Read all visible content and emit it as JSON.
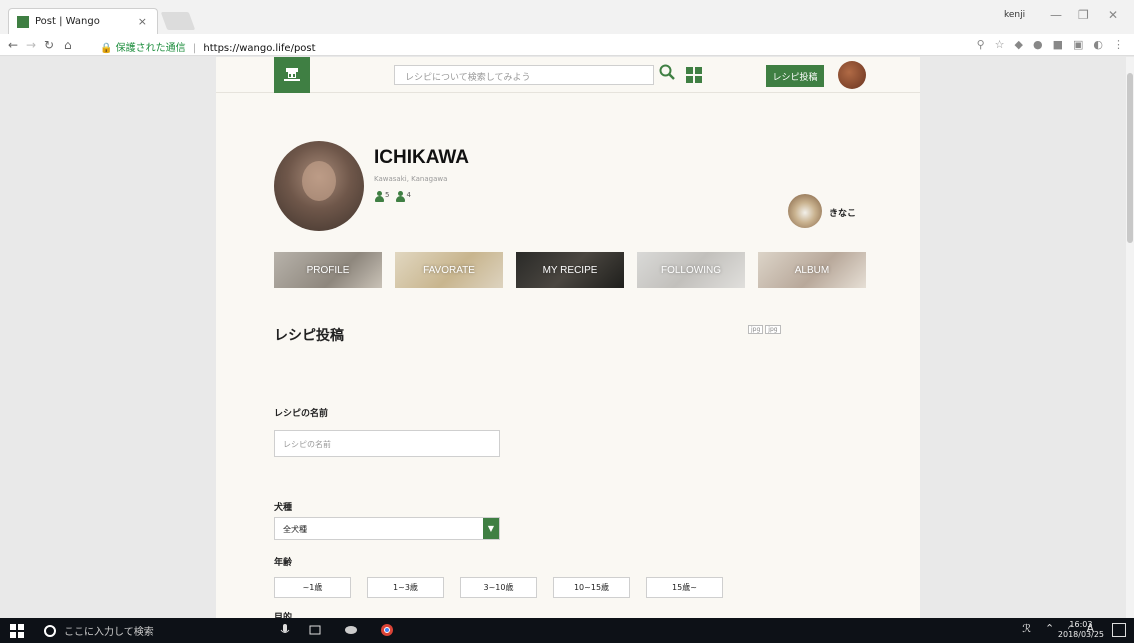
{
  "browser": {
    "tab_title": "Post | Wango",
    "tab_close": "×",
    "profile_user": "kenji",
    "win_minimize": "—",
    "win_restore": "❐",
    "win_close": "✕",
    "secure_label": "保護された通信",
    "url_sep": "|",
    "url": "https://wango.life/post"
  },
  "header": {
    "search_placeholder": "レシピについて検索してみよう",
    "post_button": "レシピ投稿"
  },
  "profile": {
    "name": "ICHIKAWA",
    "location": "Kawasaki, Kanagawa",
    "followers": "5",
    "following": "4",
    "dog_name": "きなこ"
  },
  "tabs": [
    {
      "label": "PROFILE"
    },
    {
      "label": "FAVORATE"
    },
    {
      "label": "MY RECIPE"
    },
    {
      "label": "FOLLOWING"
    },
    {
      "label": "ALBUM"
    }
  ],
  "broken_images": [
    "jpg",
    "jpg"
  ],
  "form": {
    "title": "レシピ投稿",
    "recipe_name_label": "レシピの名前",
    "recipe_name_placeholder": "レシピの名前",
    "breed_label": "犬種",
    "breed_value": "全犬種",
    "age_label": "年齢",
    "age_options": [
      "~1歳",
      "1~3歳",
      "3~10歳",
      "10~15歳",
      "15歳~"
    ],
    "next_label": "目的"
  },
  "taskbar": {
    "search_text": "ここに入力して検索",
    "ime": "A",
    "time": "16:03",
    "date": "2018/03/25"
  }
}
